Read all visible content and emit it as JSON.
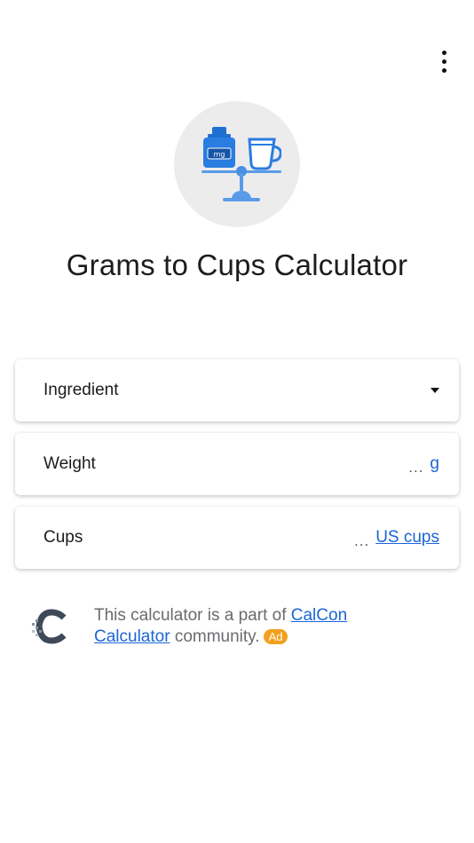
{
  "app": {
    "title": "Grams to Cups Calculator",
    "hero_icon": "scale-weight-cup-icon",
    "menu_icon": "more-vertical-icon"
  },
  "fields": {
    "ingredient": {
      "label": "Ingredient",
      "icon": "dropdown-caret-icon"
    },
    "weight": {
      "label": "Weight",
      "value": "...",
      "unit": "g"
    },
    "cups": {
      "label": "Cups",
      "value": "...",
      "unit": "US cups"
    }
  },
  "community": {
    "prefix": "This calculator is a part of ",
    "link_text_1": "CalCon",
    "link_text_2": "Calculator",
    "suffix": " community.",
    "badge": "Ad",
    "logo_icon": "calcon-logo-icon"
  },
  "colors": {
    "link": "#1a66d6",
    "badge": "#f2a11e",
    "hero_bg": "#ececec",
    "icon_blue": "#2a7de1"
  }
}
